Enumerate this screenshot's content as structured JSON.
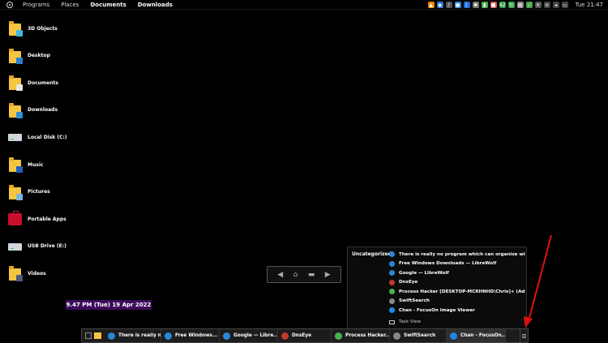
{
  "topbar": {
    "menus": [
      "Programs",
      "Places",
      "Documents",
      "Downloads"
    ],
    "clock": "Tue 21:47",
    "tray_icons": [
      {
        "name": "vlc-icon",
        "color": "#f08a00",
        "glyph": "▲"
      },
      {
        "name": "shield-icon",
        "color": "#2e7bd1",
        "glyph": "◆"
      },
      {
        "name": "music-icon",
        "color": "#555555",
        "glyph": "♪"
      },
      {
        "name": "globe-icon",
        "color": "#3a8fd9",
        "glyph": "●"
      },
      {
        "name": "bluetooth-icon",
        "color": "#1e6fd9",
        "glyph": "ᛒ"
      },
      {
        "name": "cog-icon",
        "color": "#777777",
        "glyph": "✱"
      },
      {
        "name": "battery-icon",
        "color": "#4caf50",
        "glyph": "▮"
      },
      {
        "name": "app-icon",
        "color": "#d65c5c",
        "glyph": "■"
      },
      {
        "name": "cpu-icon",
        "color": "#2e9c4a",
        "glyph": "42"
      },
      {
        "name": "sync-icon",
        "color": "#3aa655",
        "glyph": "↻"
      },
      {
        "name": "doc-icon",
        "color": "#888888",
        "glyph": "▤"
      },
      {
        "name": "check-icon",
        "color": "#4aa84a",
        "glyph": "✓"
      },
      {
        "name": "volume-mute-icon",
        "color": "#555555",
        "glyph": "✕"
      },
      {
        "name": "wifi-icon",
        "color": "#444444",
        "glyph": "≋"
      },
      {
        "name": "speaker-icon",
        "color": "#444444",
        "glyph": "◂"
      },
      {
        "name": "chat-icon",
        "color": "#444444",
        "glyph": "▭"
      }
    ]
  },
  "desktop": {
    "items": [
      {
        "label": "3D Objects",
        "kind": "folder",
        "badge": "#3fb6e0"
      },
      {
        "label": "Desktop",
        "kind": "folder",
        "badge": "#2a7fd4"
      },
      {
        "label": "Documents",
        "kind": "folder",
        "badge": "#e8e8e8"
      },
      {
        "label": "Downloads",
        "kind": "folder",
        "badge": "#2e8fd8"
      },
      {
        "label": "Local Disk (C:)",
        "kind": "drive"
      },
      {
        "label": "Music",
        "kind": "folder",
        "badge": "#1f5fbf"
      },
      {
        "label": "Pictures",
        "kind": "folder",
        "badge": "#7fb3e0"
      },
      {
        "label": "Portable Apps",
        "kind": "portable"
      },
      {
        "label": "USB Drive (E:)",
        "kind": "drive"
      },
      {
        "label": "Videos",
        "kind": "folder",
        "badge": "#4c5a80"
      }
    ]
  },
  "datetime_widget": "9.47 PM (Tue) 19 Apr 2022",
  "nav_widget": {
    "prev": "◀",
    "home": "⌂",
    "screen": "▬",
    "next": "▶"
  },
  "popup": {
    "category": "Uncategorized",
    "items": [
      {
        "label": "There is really no program which can organize win...",
        "color": "#2a86d6"
      },
      {
        "label": "Free Windows Downloads — LibreWolf",
        "color": "#2a86d6"
      },
      {
        "label": "Google — LibreWolf",
        "color": "#2a86d6"
      },
      {
        "label": "DnsEye",
        "color": "#c0392b"
      },
      {
        "label": "Process Hacker [DESKTOP-MCRHNHD\\Chris]+ (Ad...",
        "color": "#4caf50"
      },
      {
        "label": "SwiftSearch",
        "color": "#888888"
      },
      {
        "label": "Chan - FocusOn Image Viewer",
        "color": "#1e88e5"
      }
    ],
    "task_view": "Task View"
  },
  "taskbar": {
    "buttons": [
      {
        "label": "There is really n...",
        "color": "#2a86d6"
      },
      {
        "label": "Free Windows...",
        "color": "#2a86d6"
      },
      {
        "label": "Google — Libre...",
        "color": "#2a86d6"
      },
      {
        "label": "DnsEye",
        "color": "#c0392b"
      },
      {
        "label": "Process Hacker...",
        "color": "#4caf50"
      },
      {
        "label": "SwiftSearch",
        "color": "#888888"
      },
      {
        "label": "Chan - FocusOn...",
        "color": "#1e88e5"
      }
    ]
  },
  "annotation_color": "#e01010"
}
